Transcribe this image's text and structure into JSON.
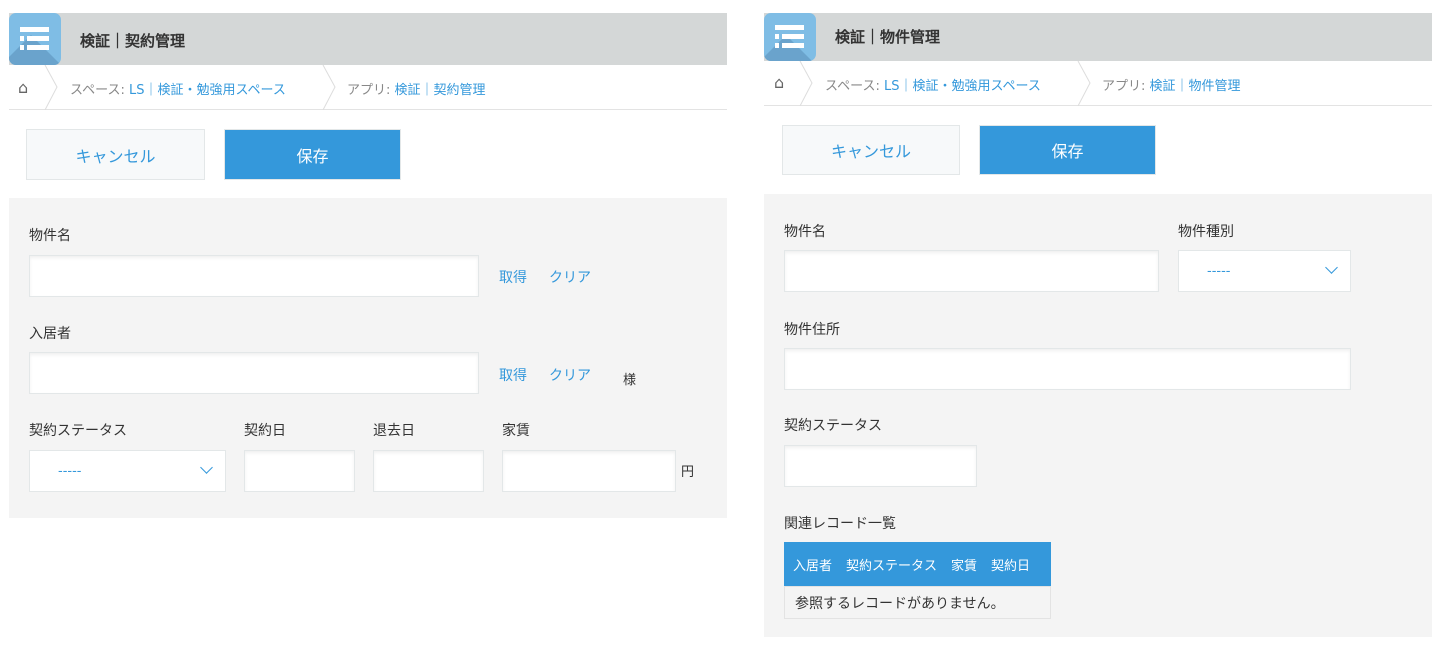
{
  "left": {
    "title": "検証｜契約管理",
    "breadcrumb": {
      "space_prefix": "スペース: ",
      "space": "LS｜検証・勉強用スペース",
      "app_prefix": "アプリ: ",
      "app": "検証｜契約管理"
    },
    "cancel": "キャンセル",
    "save": "保存",
    "fields": {
      "property_name": "物件名",
      "tenant": "入居者",
      "fetch": "取得",
      "clear": "クリア",
      "honorific": "様",
      "status": "契約ステータス",
      "status_value": "-----",
      "contract_date": "契約日",
      "moveout_date": "退去日",
      "rent": "家賃",
      "yen": "円"
    }
  },
  "right": {
    "title": "検証｜物件管理",
    "breadcrumb": {
      "space_prefix": "スペース: ",
      "space": "LS｜検証・勉強用スペース",
      "app_prefix": "アプリ: ",
      "app": "検証｜物件管理"
    },
    "cancel": "キャンセル",
    "save": "保存",
    "fields": {
      "property_name": "物件名",
      "property_type": "物件種別",
      "property_type_value": "-----",
      "address": "物件住所",
      "status": "契約ステータス",
      "related": "関連レコード一覧"
    },
    "table": {
      "headers": [
        "入居者",
        "契約ステータス",
        "家賃",
        "契約日"
      ],
      "empty": "参照するレコードがありません。"
    }
  }
}
